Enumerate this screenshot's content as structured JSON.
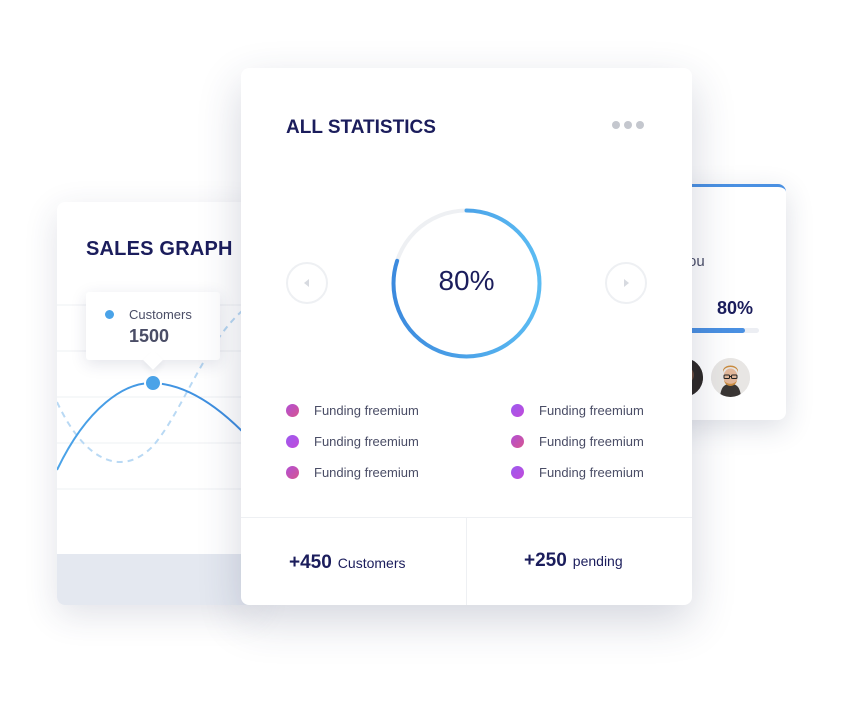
{
  "sales_graph": {
    "title": "SALES GRAPH",
    "tooltip": {
      "label": "Customers",
      "value": "1500"
    }
  },
  "main_card": {
    "title": "ALL STATISTICS",
    "progress": {
      "label": "80%",
      "value": 80
    },
    "legend": [
      {
        "label": "Funding freemium"
      },
      {
        "label": "Funding freemium"
      },
      {
        "label": "Funding freemium"
      },
      {
        "label": "Funding freemium"
      },
      {
        "label": "Funding freemium"
      },
      {
        "label": "Funding freemium"
      }
    ],
    "stats": [
      {
        "value": "+450",
        "label": "Customers"
      },
      {
        "value": "+250",
        "label": "pending"
      }
    ]
  },
  "side_card": {
    "partial_text": "ou",
    "progress": {
      "label": "80%",
      "value": 80
    }
  },
  "colors": {
    "accent": "#4a90e2",
    "navy": "#1b1d5c",
    "legend_dot_a": "#c152b5",
    "legend_dot_b": "#a755ea"
  },
  "icons": [
    "more-horizontal-icon",
    "chevron-left-icon",
    "chevron-right-icon"
  ]
}
